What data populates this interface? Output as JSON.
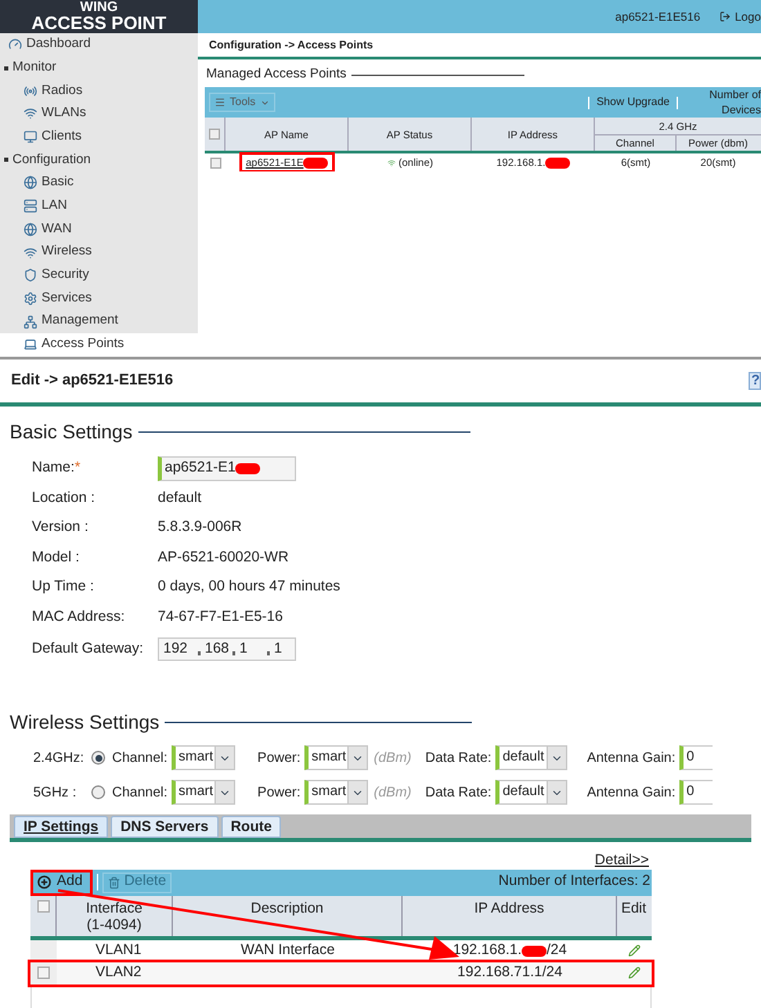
{
  "top_window": {
    "brand": [
      "WING",
      "ACCESS POINT"
    ],
    "user": "ap6521-E1E516",
    "logout": "Logo",
    "sidebar": [
      {
        "label": "Dashboard",
        "kind": "dashboard",
        "selected": false
      },
      {
        "label": "Monitor",
        "kind": "group",
        "expanded": true,
        "children": [
          {
            "label": "Radios",
            "kind": "radio",
            "selected": false
          },
          {
            "label": "WLANs",
            "kind": "wlan",
            "selected": false
          },
          {
            "label": "Clients",
            "kind": "clients",
            "selected": false
          }
        ]
      },
      {
        "label": "Configuration",
        "kind": "group",
        "expanded": true,
        "children": [
          {
            "label": "Basic",
            "kind": "globe",
            "selected": false
          },
          {
            "label": "LAN",
            "kind": "lan",
            "selected": false
          },
          {
            "label": "WAN",
            "kind": "globe",
            "selected": false
          },
          {
            "label": "Wireless",
            "kind": "wireless",
            "selected": false
          },
          {
            "label": "Security",
            "kind": "security",
            "selected": false
          },
          {
            "label": "Services",
            "kind": "services",
            "selected": false
          },
          {
            "label": "Management",
            "kind": "management",
            "selected": false
          },
          {
            "label": "Access Points",
            "kind": "ap",
            "selected": true
          }
        ]
      }
    ],
    "breadcrumb": "Configuration -> Access Points",
    "section_title": "Managed Access Points",
    "select_all_checked": false,
    "toolbar": {
      "tools": "Tools",
      "show_upgrade": "Show Upgrade",
      "column_cut": [
        "Number of",
        "Devices"
      ]
    },
    "table": {
      "columns": [
        "AP Name",
        "AP Status",
        "IP Address"
      ],
      "group": "2.4 GHz",
      "subcolumns": [
        "Channel",
        "Power (dbm)"
      ],
      "rows": [
        {
          "ap_name": "ap6521-E1E",
          "highlighted": true,
          "redacted": true,
          "status": "(online)",
          "ip": "192.168.1.",
          "channel": "6(smt)",
          "power": "20(smt)",
          "checked": false
        }
      ]
    }
  },
  "edit_page": {
    "title": "Edit -> ap6521-E1E516",
    "help": "?",
    "basic": {
      "title": "Basic Settings",
      "name_label": "Name:",
      "required_mark": "*",
      "name_value": "ap6521-E1",
      "fields": [
        {
          "label": "Location :",
          "value": "default"
        },
        {
          "label": "Version :",
          "value": "5.8.3.9-006R"
        },
        {
          "label": "Model :",
          "value": "AP-6521-60020-WR"
        },
        {
          "label": "Up Time :",
          "value": "0 days, 00 hours 47 minutes"
        },
        {
          "label": "MAC Address:",
          "value": "74-67-F7-E1-E5-16"
        }
      ],
      "gateway_label": "Default Gateway:",
      "gateway": [
        "192",
        "168",
        "1",
        "1"
      ]
    },
    "wireless": {
      "title": "Wireless Settings",
      "rows": [
        {
          "band": "2.4GHz:",
          "selected": true,
          "channel_label": "Channel:",
          "channel": "smart",
          "power_label": "Power:",
          "power": "smart",
          "unit": "(dBm)",
          "rate_label": "Data Rate:",
          "rate": "default",
          "gain_label": "Antenna Gain:",
          "gain": "0"
        },
        {
          "band": "5GHz :",
          "selected": false,
          "channel_label": "Channel:",
          "channel": "smart",
          "power_label": "Power:",
          "power": "smart",
          "unit": "(dBm)",
          "rate_label": "Data Rate:",
          "rate": "default",
          "gain_label": "Antenna Gain:",
          "gain": "0"
        }
      ]
    },
    "tabs": [
      {
        "label": "IP Settings",
        "selected": true
      },
      {
        "label": "DNS Servers",
        "selected": false
      },
      {
        "label": "Route",
        "selected": false
      }
    ],
    "detail_link": "Detail>>",
    "toolbar": {
      "add": "Add",
      "add_highlighted": true,
      "delete": "Delete",
      "delete_disabled": true,
      "count": "Number of Interfaces: 2"
    },
    "select_all_checked": false,
    "table": {
      "columns": [
        "Interface\n(1-4094)",
        "Description",
        "IP Address",
        "Edit"
      ],
      "rows": [
        {
          "interface": "VLAN1",
          "description": "WAN Interface",
          "ip_parts": [
            "192.168.1.",
            "/24"
          ],
          "redacted": true,
          "highlighted": false,
          "has_checkbox": false
        },
        {
          "interface": "VLAN2",
          "description": "",
          "ip_parts": [
            "192.168.71.1/24"
          ],
          "redacted": false,
          "highlighted": true,
          "has_checkbox": true
        }
      ]
    }
  }
}
